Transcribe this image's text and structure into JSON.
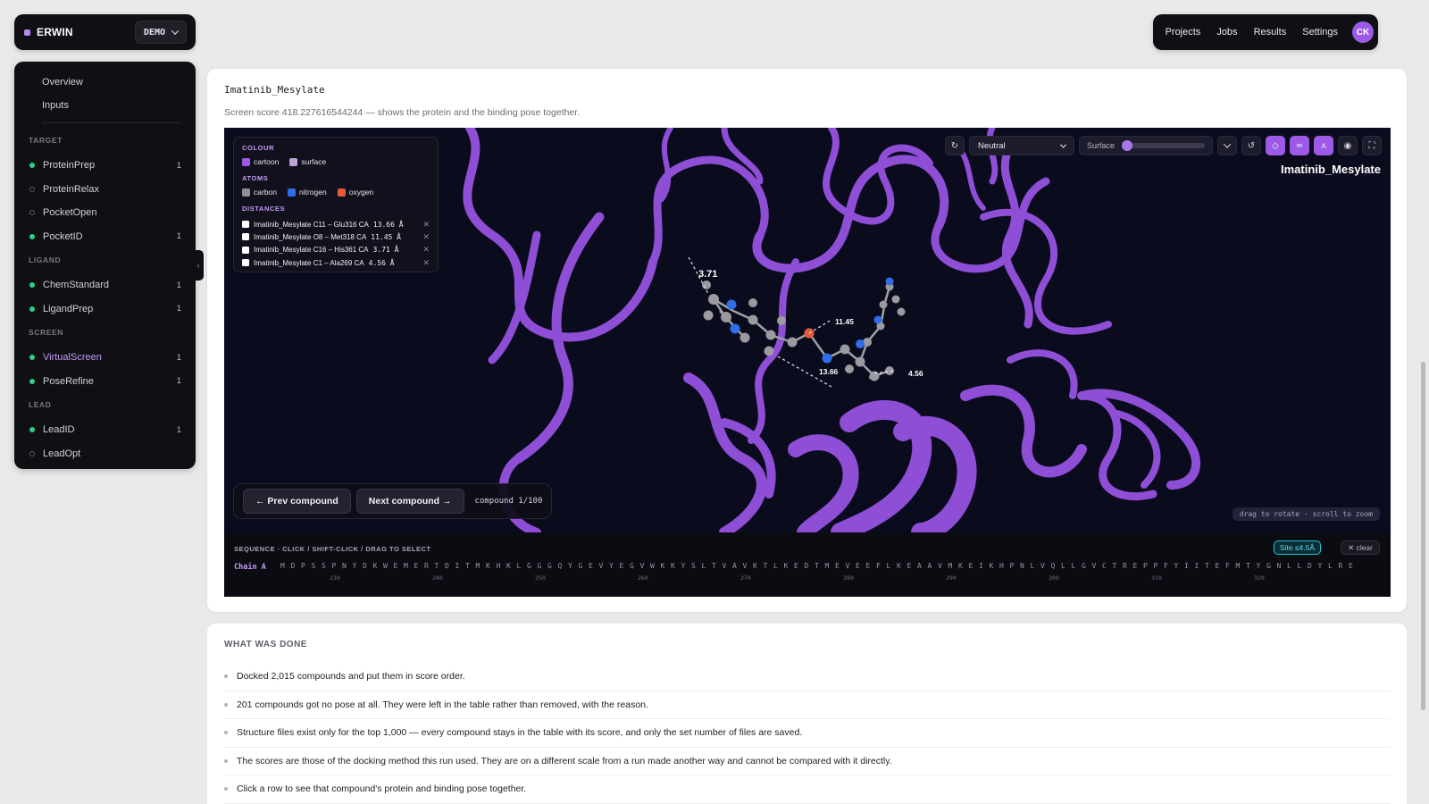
{
  "brand": {
    "name": "ERWIN",
    "env_label": "DEMO"
  },
  "topnav": {
    "items": [
      "Projects",
      "Jobs",
      "Results",
      "Settings"
    ],
    "avatar": "CK"
  },
  "sidebar": {
    "top_items": [
      "Overview",
      "Inputs"
    ],
    "sections": [
      {
        "label": "TARGET",
        "items": [
          {
            "label": "ProteinPrep",
            "count": "1",
            "status": "done"
          },
          {
            "label": "ProteinRelax",
            "count": "",
            "status": "pending"
          },
          {
            "label": "PocketOpen",
            "count": "",
            "status": "pending"
          },
          {
            "label": "PocketID",
            "count": "1",
            "status": "done"
          }
        ]
      },
      {
        "label": "LIGAND",
        "items": [
          {
            "label": "ChemStandard",
            "count": "1",
            "status": "done"
          },
          {
            "label": "LigandPrep",
            "count": "1",
            "status": "done"
          }
        ]
      },
      {
        "label": "SCREEN",
        "items": [
          {
            "label": "VirtualScreen",
            "count": "1",
            "status": "done",
            "active": true
          },
          {
            "label": "PoseRefine",
            "count": "1",
            "status": "done"
          }
        ]
      },
      {
        "label": "LEAD",
        "items": [
          {
            "label": "LeadID",
            "count": "1",
            "status": "done"
          },
          {
            "label": "LeadOpt",
            "count": "",
            "status": "pending"
          }
        ]
      }
    ]
  },
  "main": {
    "title": "Imatinib_Mesylate",
    "subtitle": "Screen score 418.227616544244 — shows the protein and the binding pose together."
  },
  "viewer": {
    "legend": {
      "colour_header": "COLOUR",
      "colour_items": [
        {
          "label": "cartoon",
          "color": "#9c5ae6"
        },
        {
          "label": "surface",
          "color": "#b9a3d8"
        }
      ],
      "atoms_header": "ATOMS",
      "atom_items": [
        {
          "label": "carbon",
          "color": "#8f8f96"
        },
        {
          "label": "nitrogen",
          "color": "#2f6ee6"
        },
        {
          "label": "oxygen",
          "color": "#e35a3a"
        }
      ],
      "distances_header": "DISTANCES",
      "distances": [
        {
          "label": "Imatinib_Mesylate C11 – Glu316 CA",
          "value": "13.66 Å"
        },
        {
          "label": "Imatinib_Mesylate O8 – Met318 CA",
          "value": "11.45 Å"
        },
        {
          "label": "Imatinib_Mesylate C16 – His361 CA",
          "value": "3.71 Å"
        },
        {
          "label": "Imatinib_Mesylate C1 – Ala269 CA",
          "value": "4.56 Å"
        }
      ]
    },
    "charge_select": "Neutral",
    "surface_label": "Surface",
    "surface_opacity": 0.0,
    "molecule_name": "Imatinib_Mesylate",
    "distance_labels": {
      "a": "3.71",
      "b": "11.45",
      "c": "13.66",
      "d": "4.56"
    },
    "prev_label": "← Prev compound",
    "next_label": "Next compound →",
    "compound_counter": "compound 1/100",
    "hint": "drag to rotate · scroll to zoom",
    "cartoon_color": "#9c5ae6",
    "background_color": "#0b0b1e"
  },
  "sequence": {
    "header": "SEQUENCE · CLICK / SHIFT-CLICK / DRAG TO SELECT",
    "site_badge": "Site ≤4.5Å",
    "clear_label": "clear",
    "chain_label": "Chain A",
    "residues": "MDPSSPNYDKWEMERTDITMKHKLGGGQYGEVYEGVWKKYSLTVAVKTLKEDTMEVEEFLKEAAVMKEIKHPNLVQLLGVCTREPPFYIITEFMTYGNLLDYLRE",
    "ticks": [
      "230",
      "240",
      "250",
      "260",
      "270",
      "280",
      "290",
      "300",
      "310",
      "320"
    ]
  },
  "done": {
    "header": "WHAT WAS DONE",
    "items": [
      "Docked 2,015 compounds and put them in score order.",
      "201 compounds got no pose at all. They were left in the table rather than removed, with the reason.",
      "Structure files exist only for the top 1,000 — every compound stays in the table with its score, and only the set number of files are saved.",
      "The scores are those of the docking method this run used. They are on a different scale from a run made another way and cannot be compared with it directly.",
      "Click a row to see that compound's protein and binding pose together."
    ]
  }
}
